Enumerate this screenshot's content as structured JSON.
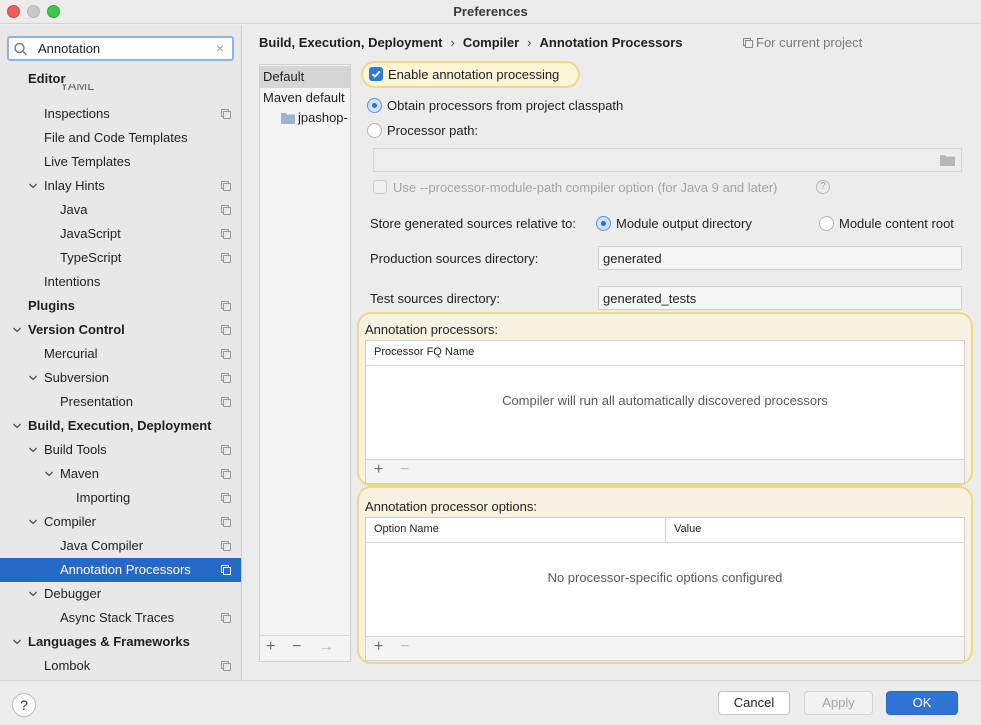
{
  "window": {
    "title": "Preferences"
  },
  "search": {
    "value": "Annotation"
  },
  "sidebar": {
    "items": [
      {
        "label": "Editor",
        "bold": true
      },
      {
        "label": "YAML"
      },
      {
        "label": "Inspections"
      },
      {
        "label": "File and Code Templates"
      },
      {
        "label": "Live Templates"
      },
      {
        "label": "Inlay Hints"
      },
      {
        "label": "Java"
      },
      {
        "label": "JavaScript"
      },
      {
        "label": "TypeScript"
      },
      {
        "label": "Intentions"
      },
      {
        "label": "Plugins",
        "bold": true
      },
      {
        "label": "Version Control",
        "bold": true
      },
      {
        "label": "Mercurial"
      },
      {
        "label": "Subversion"
      },
      {
        "label": "Presentation"
      },
      {
        "label": "Build, Execution, Deployment",
        "bold": true
      },
      {
        "label": "Build Tools"
      },
      {
        "label": "Maven"
      },
      {
        "label": "Importing"
      },
      {
        "label": "Compiler"
      },
      {
        "label": "Java Compiler"
      },
      {
        "label": "Annotation Processors",
        "selected": true
      },
      {
        "label": "Debugger"
      },
      {
        "label": "Async Stack Traces"
      },
      {
        "label": "Languages & Frameworks",
        "bold": true
      },
      {
        "label": "Lombok"
      }
    ]
  },
  "breadcrumb": {
    "parts": [
      "Build, Execution, Deployment",
      "Compiler",
      "Annotation Processors"
    ],
    "separator": "›",
    "scope": "For current project"
  },
  "profiles": {
    "items": [
      "Default",
      "Maven default",
      "jpashop-"
    ],
    "tools": {
      "add": "+",
      "remove": "−",
      "move": "→"
    }
  },
  "settings": {
    "enable_label": "Enable annotation processing",
    "enable_checked": true,
    "obtain_label": "Obtain processors from project classpath",
    "obtain_selected": true,
    "processor_path_label": "Processor path:",
    "module_path_label": "Use --processor-module-path compiler option (for Java 9 and later)",
    "store_label": "Store generated sources relative to:",
    "store_options": [
      "Module output directory",
      "Module content root"
    ],
    "store_selected": "Module output directory",
    "production_label": "Production sources directory:",
    "production_value": "generated",
    "test_label": "Test sources directory:",
    "test_value": "generated_tests"
  },
  "processors_table": {
    "title": "Annotation processors:",
    "columns": [
      "Processor FQ Name"
    ],
    "empty_text": "Compiler will run all automatically discovered processors",
    "tools": {
      "add": "+",
      "remove": "−"
    }
  },
  "options_table": {
    "title": "Annotation processor options:",
    "columns": [
      "Option Name",
      "Value"
    ],
    "empty_text": "No processor-specific options configured",
    "tools": {
      "add": "+",
      "remove": "−"
    }
  },
  "buttons": {
    "help": "?",
    "cancel": "Cancel",
    "apply": "Apply",
    "ok": "OK"
  },
  "colors": {
    "accent": "#2668c7",
    "highlight": "#f0d88a",
    "ok_button": "#2e74d5"
  }
}
